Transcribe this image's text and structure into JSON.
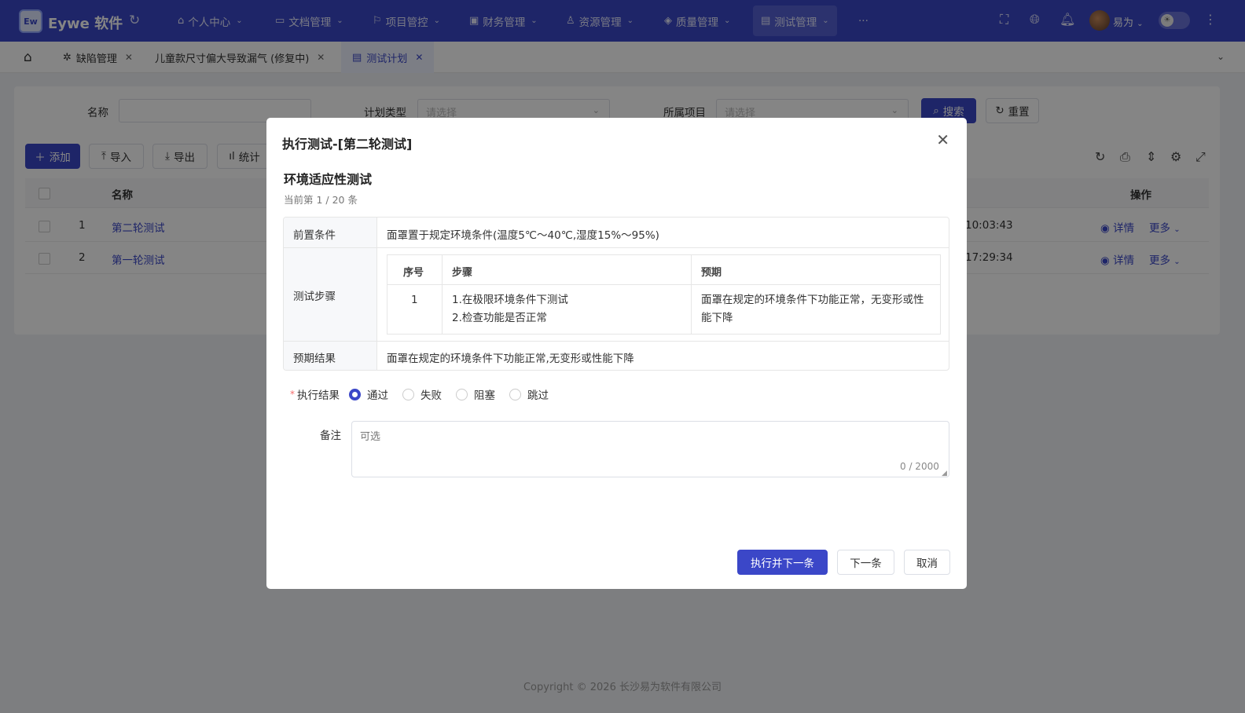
{
  "app": {
    "logo_text": "Ew",
    "title": "Eywe 软件"
  },
  "nav": {
    "items": [
      {
        "label": "个人中心",
        "icon": "⌂"
      },
      {
        "label": "文档管理",
        "icon": "▭"
      },
      {
        "label": "项目管控",
        "icon": "⚐"
      },
      {
        "label": "财务管理",
        "icon": "▣"
      },
      {
        "label": "资源管理",
        "icon": "♙"
      },
      {
        "label": "质量管理",
        "icon": "◈"
      },
      {
        "label": "测试管理",
        "icon": "▤",
        "active": true
      }
    ],
    "more": "···",
    "user_name": "易为"
  },
  "tabs": {
    "items": [
      {
        "label": "缺陷管理",
        "icon": "✲"
      },
      {
        "label": "儿童款尺寸偏大导致漏气 (修复中)",
        "icon": ""
      },
      {
        "label": "测试计划",
        "icon": "▤",
        "active": true
      }
    ]
  },
  "filters": {
    "name_label": "名称",
    "plan_type_label": "计划类型",
    "plan_type_placeholder": "请选择",
    "project_label": "所属项目",
    "project_placeholder": "请选择",
    "search_label": "搜索",
    "reset_label": "重置"
  },
  "toolbar": {
    "add_label": "添加",
    "import_label": "导入",
    "export_label": "导出",
    "stats_label": "统计"
  },
  "table": {
    "headers": {
      "name": "名称",
      "actions": "操作"
    },
    "rows": [
      {
        "index": "1",
        "name": "第二轮测试",
        "time": "10:03:43",
        "detail": "详情",
        "more": "更多"
      },
      {
        "index": "2",
        "name": "第一轮测试",
        "time": "17:29:34",
        "detail": "详情",
        "more": "更多"
      }
    ]
  },
  "footer": {
    "copyright": "Copyright © 2026 长沙易为软件有限公司"
  },
  "modal": {
    "title": "执行测试-[第二轮测试]",
    "case_title": "环境适应性测试",
    "progress": "当前第 1 / 20 条",
    "precondition_label": "前置条件",
    "precondition_value": "面罩置于规定环境条件(温度5℃～40℃,湿度15%～95%)",
    "steps_label": "测试步骤",
    "steps_headers": {
      "index": "序号",
      "step": "步骤",
      "expected": "预期"
    },
    "steps": [
      {
        "index": "1",
        "step_line1": "1.在极限环境条件下测试",
        "step_line2": "2.检查功能是否正常",
        "expected_line1": "面罩在规定的环境条件下功能正常，无变形或性",
        "expected_line2": "能下降"
      }
    ],
    "expected_result_label": "预期结果",
    "expected_result_value": "面罩在规定的环境条件下功能正常,无变形或性能下降",
    "result_label": "执行结果",
    "result_options": [
      "通过",
      "失败",
      "阻塞",
      "跳过"
    ],
    "result_selected": "通过",
    "remark_label": "备注",
    "remark_placeholder": "可选",
    "remark_counter": "0 / 2000",
    "execute_next_label": "执行并下一条",
    "next_label": "下一条",
    "cancel_label": "取消"
  },
  "colors": {
    "primary": "#3b47c8",
    "nav_bg": "#3b47c8",
    "required": "#f56c6c"
  }
}
